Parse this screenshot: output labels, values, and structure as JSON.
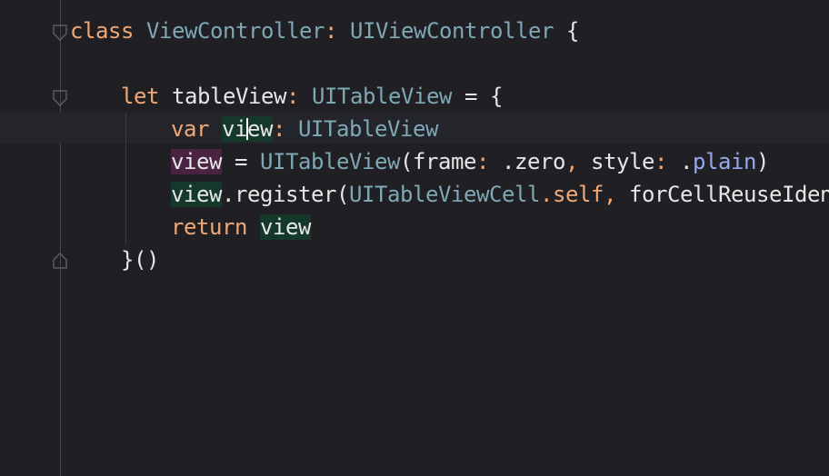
{
  "colors": {
    "background": "#1f1f24",
    "keyword": "#f2a875",
    "type": "#7fa8b5",
    "plain": "#e6e6e6",
    "member": "#99a8ee",
    "highlight_green": "#14392a",
    "highlight_purple": "#4a2343"
  },
  "code": {
    "line1": {
      "kw_class": "class",
      "class_name": "ViewController",
      "colon": ":",
      "superclass": "UIViewController",
      "brace": "{"
    },
    "line3": {
      "kw_let": "let",
      "var_name": "tableView",
      "colon": ":",
      "type": "UITableView",
      "eq_brace": "= {"
    },
    "line4": {
      "kw_var": "var",
      "var_a": "vi",
      "var_b": "ew",
      "colon": ":",
      "type": "UITableView"
    },
    "line5": {
      "var": "view",
      "eq": "=",
      "type": "UITableView",
      "paren": "(frame",
      "colon1": ":",
      "zero": ".zero",
      "comma": ",",
      "style": "style",
      "colon2": ":",
      "dot": ".",
      "plain": "plain",
      "close": ")"
    },
    "line6": {
      "var": "view",
      "call": ".register(",
      "cell_type": "UITableViewCell",
      "dot_self": ".self",
      "comma": ",",
      "arg": "forCellReuseIdentifier"
    },
    "line7": {
      "kw_return": "return",
      "var": "view"
    },
    "line8": {
      "close": "}()"
    }
  }
}
